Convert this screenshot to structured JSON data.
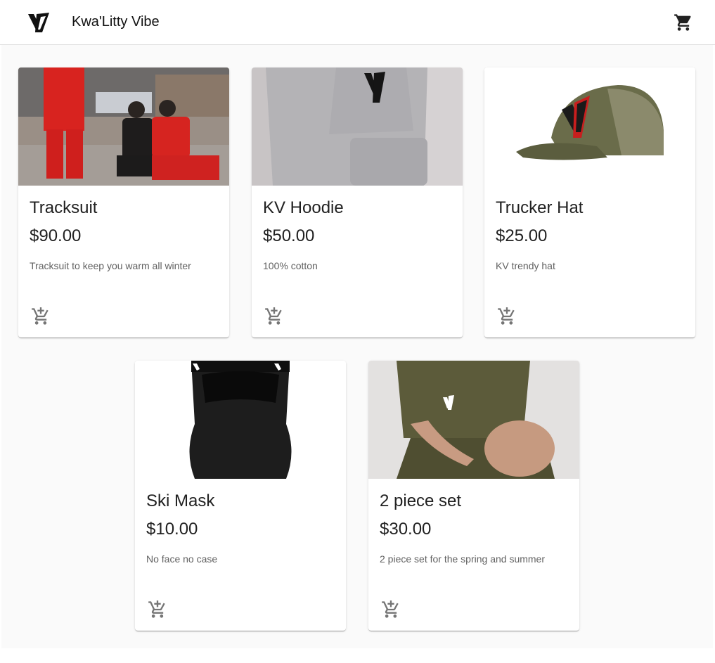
{
  "app": {
    "title": "Kwa'Litty Vibe",
    "logo_icon": "kv-logo-icon",
    "cart_icon": "shopping-cart-icon"
  },
  "products": [
    {
      "name": "Tracksuit",
      "price": "$90.00",
      "description": "Tracksuit to keep you warm all winter",
      "image": "tracksuit-photo"
    },
    {
      "name": "KV Hoodie",
      "price": "$50.00",
      "description": "100% cotton",
      "image": "hoodie-photo"
    },
    {
      "name": "Trucker Hat",
      "price": "$25.00",
      "description": "KV trendy hat",
      "image": "trucker-hat-photo"
    },
    {
      "name": "Ski Mask",
      "price": "$10.00",
      "description": "No face no case",
      "image": "ski-mask-photo"
    },
    {
      "name": "2 piece set",
      "price": "$30.00",
      "description": "2 piece set for the spring and summer",
      "image": "two-piece-set-photo"
    }
  ],
  "colors": {
    "background": "#fafafa",
    "appbar": "#ffffff",
    "text": "#212121",
    "icon": "#757575"
  }
}
